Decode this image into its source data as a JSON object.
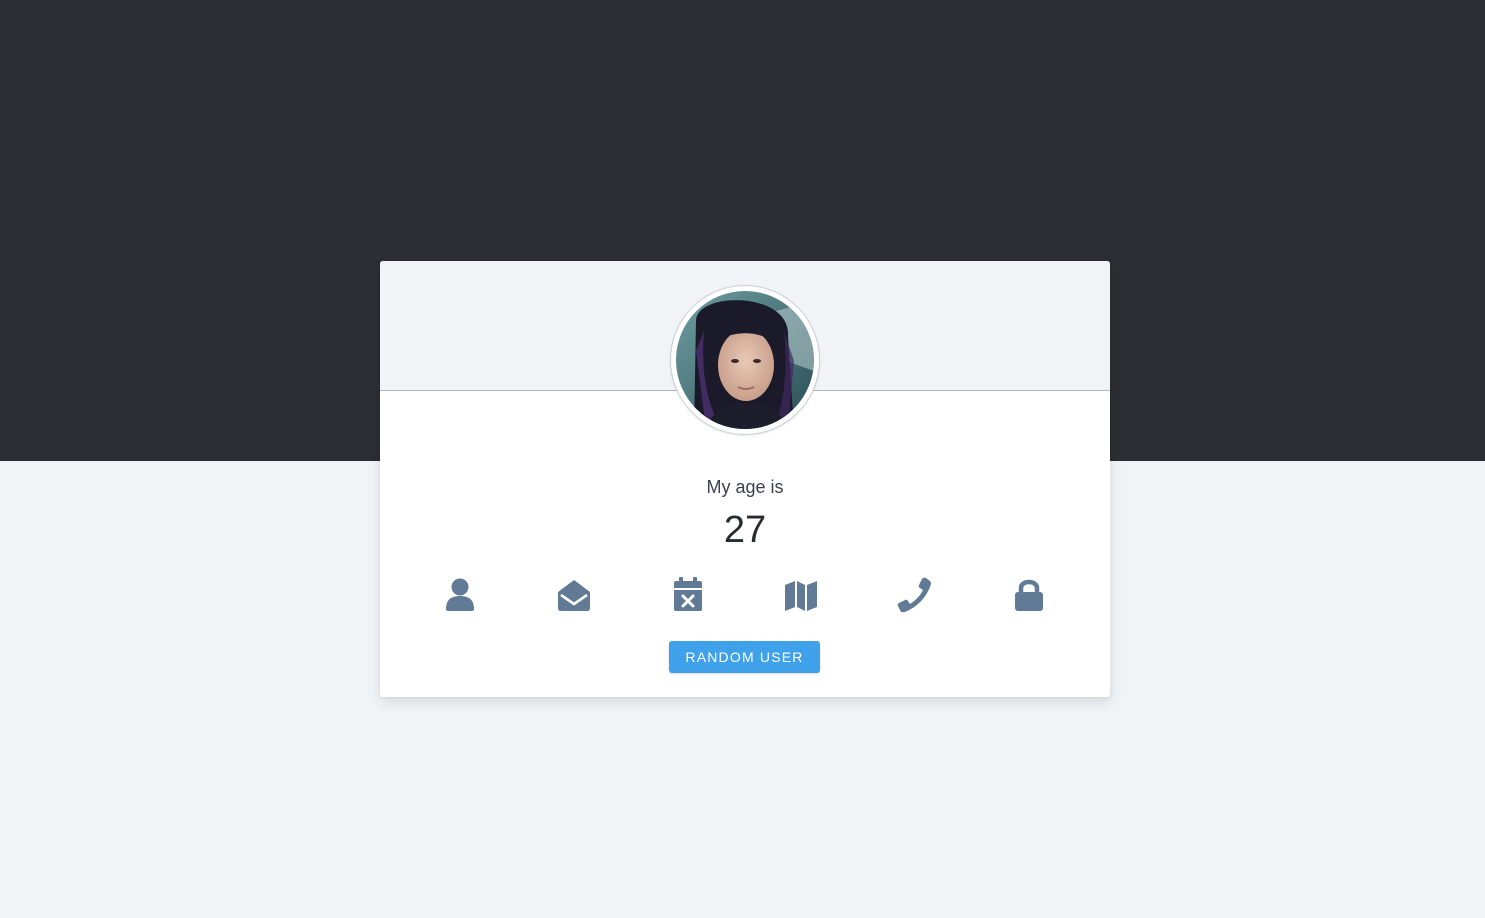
{
  "colors": {
    "top_band": "#2c2e33",
    "page_background": "#f0f4f7",
    "card_background": "#ffffff",
    "icon_color": "#617a96",
    "button_background": "#3ea1ea",
    "button_text": "#ffffff"
  },
  "profile": {
    "label": "My age is",
    "value": "27"
  },
  "icons": [
    {
      "name": "user-icon"
    },
    {
      "name": "envelope-open-icon"
    },
    {
      "name": "calendar-x-icon"
    },
    {
      "name": "map-icon"
    },
    {
      "name": "phone-icon"
    },
    {
      "name": "lock-icon"
    }
  ],
  "button": {
    "label": "RANDOM USER"
  }
}
